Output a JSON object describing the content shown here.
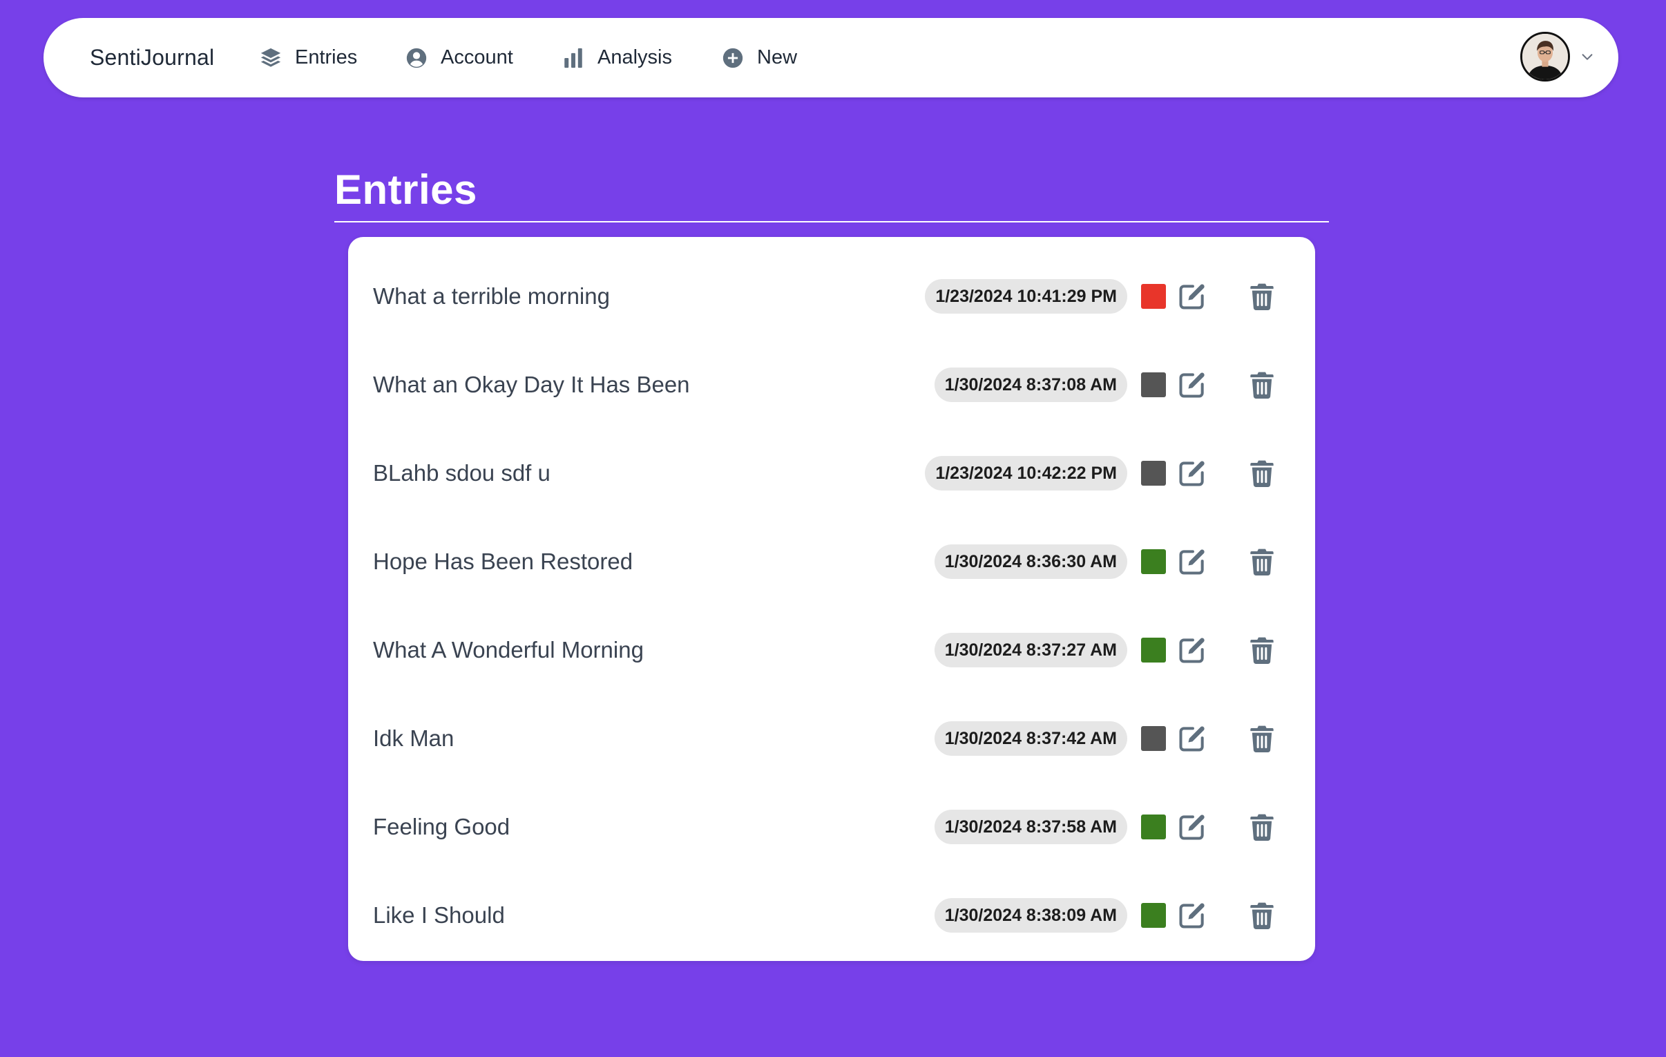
{
  "navbar": {
    "brand": "SentiJournal",
    "items": [
      {
        "label": "Entries",
        "icon": "layers-icon"
      },
      {
        "label": "Account",
        "icon": "user-circle-icon"
      },
      {
        "label": "Analysis",
        "icon": "bar-chart-icon"
      },
      {
        "label": "New",
        "icon": "plus-circle-icon"
      }
    ],
    "user_menu": {
      "avatar": "avatar",
      "icon": "chevron-down-icon"
    }
  },
  "main": {
    "title": "Entries",
    "entries": [
      {
        "title": "What a terrible morning",
        "timestamp": "1/23/2024 10:41:29 PM",
        "sentiment": "negative"
      },
      {
        "title": "What an Okay Day It Has Been",
        "timestamp": "1/30/2024 8:37:08 AM",
        "sentiment": "neutral"
      },
      {
        "title": "BLahb sdou sdf u",
        "timestamp": "1/23/2024 10:42:22 PM",
        "sentiment": "neutral"
      },
      {
        "title": "Hope Has Been Restored",
        "timestamp": "1/30/2024 8:36:30 AM",
        "sentiment": "positive"
      },
      {
        "title": "What A Wonderful Morning",
        "timestamp": "1/30/2024 8:37:27 AM",
        "sentiment": "positive"
      },
      {
        "title": "Idk Man",
        "timestamp": "1/30/2024 8:37:42 AM",
        "sentiment": "neutral"
      },
      {
        "title": "Feeling Good",
        "timestamp": "1/30/2024 8:37:58 AM",
        "sentiment": "positive"
      },
      {
        "title": "Like I Should",
        "timestamp": "1/30/2024 8:38:09 AM",
        "sentiment": "positive"
      }
    ],
    "row_actions": {
      "edit_icon": "edit-icon",
      "delete_icon": "trash-icon"
    }
  },
  "colors": {
    "background": "#7740e9",
    "negative": "#e8352a",
    "neutral": "#555555",
    "positive": "#3b7f1f",
    "icon": "#5f6f7e"
  }
}
